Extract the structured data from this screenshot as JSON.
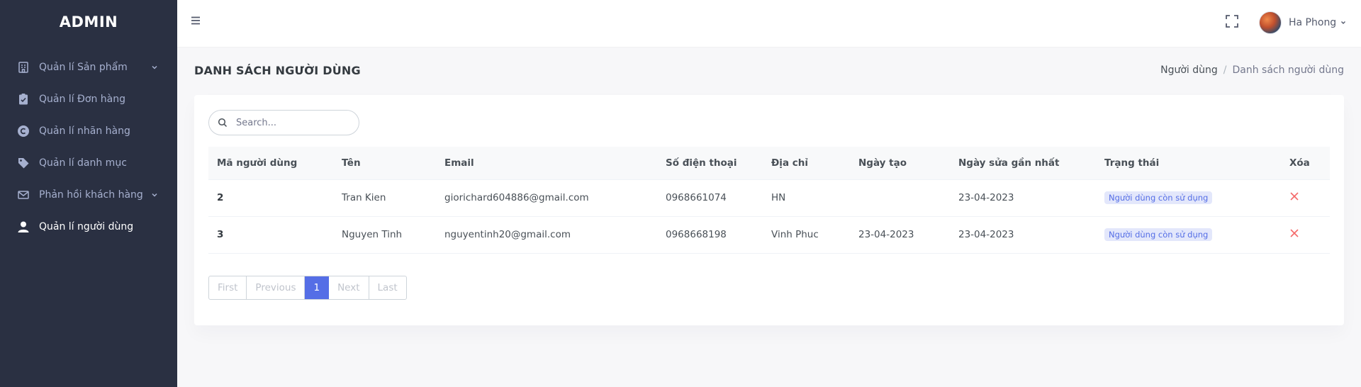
{
  "brand": "ADMIN",
  "sidebar": {
    "items": [
      {
        "label": "Quản lí Sản phẩm",
        "icon": "building-icon"
      },
      {
        "label": "Quản lí Đơn hàng",
        "icon": "clipboard-check-icon"
      },
      {
        "label": "Quản lí nhãn hàng",
        "icon": "copyright-icon"
      },
      {
        "label": "Quản lí danh mục",
        "icon": "tag-icon"
      },
      {
        "label": "Phản hồi khách hàng",
        "icon": "envelope-icon"
      },
      {
        "label": "Quản lí người dùng",
        "icon": "user-icon"
      }
    ]
  },
  "header": {
    "user_name": "Ha Phong"
  },
  "page": {
    "title": "DANH SÁCH NGƯỜI DÙNG",
    "breadcrumb": [
      "Người dùng",
      "/",
      "Danh sách người dùng"
    ]
  },
  "search": {
    "placeholder": "Search..."
  },
  "table": {
    "headers": [
      "Mã người dùng",
      "Tên",
      "Email",
      "Số điện thoại",
      "Địa chỉ",
      "Ngày tạo",
      "Ngày sửa gần nhất",
      "Trạng thái",
      "Xóa"
    ],
    "rows": [
      {
        "id": "2",
        "name": "Tran Kien",
        "email": "giorichard604886@gmail.com",
        "phone": "0968661074",
        "address": "HN",
        "created": "",
        "updated": "23-04-2023",
        "status": "Người dùng còn sử dụng"
      },
      {
        "id": "3",
        "name": "Nguyen Tinh",
        "email": "nguyentinh20@gmail.com",
        "phone": "0968668198",
        "address": "Vinh Phuc",
        "created": "23-04-2023",
        "updated": "23-04-2023",
        "status": "Người dùng còn sử dụng"
      }
    ]
  },
  "pagination": {
    "first": "First",
    "previous": "Previous",
    "current": "1",
    "next": "Next",
    "last": "Last"
  },
  "colors": {
    "sidebar_bg": "#2a3042",
    "accent": "#556ee6",
    "delete": "#f46a6a"
  }
}
